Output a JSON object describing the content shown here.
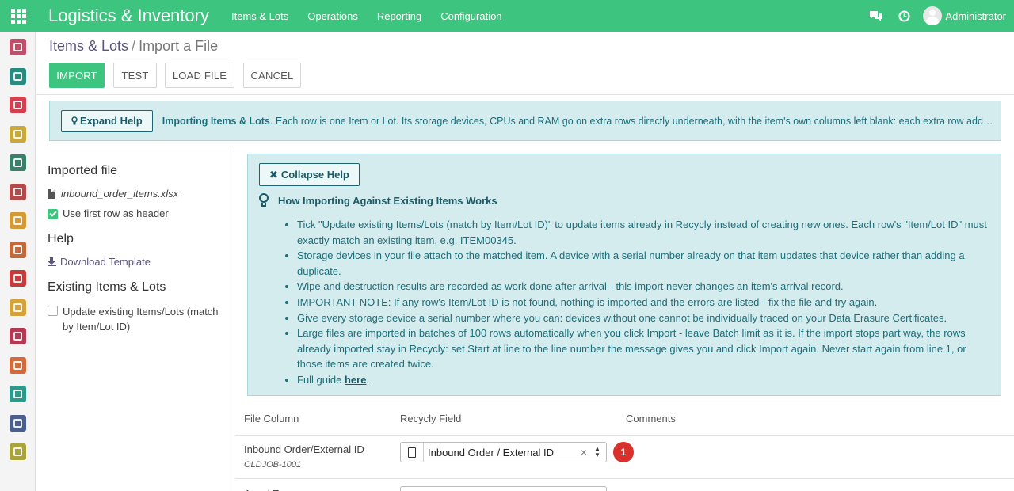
{
  "navbar": {
    "brand": "Logistics & Inventory",
    "menu": [
      "Items & Lots",
      "Operations",
      "Reporting",
      "Configuration"
    ],
    "user": "Administrator"
  },
  "sidebar_icons": [
    {
      "name": "dashboard-app-icon",
      "color": "#c0506a"
    },
    {
      "name": "contacts-app-icon",
      "color": "#2b8a80"
    },
    {
      "name": "discuss-app-icon",
      "color": "#d3404f"
    },
    {
      "name": "calendar-app-icon",
      "color": "#c8a93a"
    },
    {
      "name": "inventory-app-icon",
      "color": "#3a7f6a"
    },
    {
      "name": "stock-app-icon",
      "color": "#b5484a"
    },
    {
      "name": "packages-app-icon",
      "color": "#d49a3a"
    },
    {
      "name": "invoicing-app-icon",
      "color": "#c46a3a"
    },
    {
      "name": "marketing-app-icon",
      "color": "#c83a3a"
    },
    {
      "name": "documents-app-icon",
      "color": "#d4a43a"
    },
    {
      "name": "delivery-app-icon",
      "color": "#b33a55"
    },
    {
      "name": "website-app-icon",
      "color": "#d46a3a"
    },
    {
      "name": "employees-app-icon",
      "color": "#2b9a8a"
    },
    {
      "name": "fleet-app-icon",
      "color": "#4a5f8a"
    },
    {
      "name": "settings-app-icon",
      "color": "#a8a33a"
    }
  ],
  "breadcrumb": {
    "parent": "Items & Lots",
    "separator": "/",
    "current": "Import a File"
  },
  "toolbar": {
    "import": "IMPORT",
    "test": "TEST",
    "load_file": "LOAD FILE",
    "cancel": "CANCEL"
  },
  "helpbar": {
    "button": "Expand Help",
    "lead": "Importing Items & Lots",
    "text": ". Each row is one Item or Lot. Its storage devices, CPUs and RAM go on extra rows directly underneath, with the item's own columns left blank: each extra row add…"
  },
  "left_panel": {
    "imported_file_title": "Imported file",
    "file_name": "inbound_order_items.xlsx",
    "use_header_label": "Use first row as header",
    "help_title": "Help",
    "download_template": "Download Template",
    "existing_title": "Existing Items & Lots",
    "update_existing_label": "Update existing Items/Lots (match by Item/Lot ID)"
  },
  "help_box": {
    "button": "Collapse Help",
    "heading": "How Importing Against Existing Items Works",
    "items": [
      "Tick \"Update existing Items/Lots (match by Item/Lot ID)\" to update items already in Recycly instead of creating new ones. Each row's \"Item/Lot ID\" must exactly match an existing item, e.g. ITEM00345.",
      "Storage devices in your file attach to the matched item. A device with a serial number already on that item updates that device rather than adding a duplicate.",
      "Wipe and destruction results are recorded as work done after arrival - this import never changes an item's arrival record.",
      "IMPORTANT NOTE: If any row's Item/Lot ID is not found, nothing is imported and the errors are listed - fix the file and try again.",
      "Give every storage device a serial number where you can: devices without one cannot be individually traced on your Data Erasure Certificates.",
      "Large files are imported in batches of 100 rows automatically when you click Import - leave Batch limit as it is. If the import stops part way, the rows already imported stay in Recycly: set Start at line to the line number the message gives you and click Import again. Never start again from line 1, or those items are created twice."
    ],
    "last_item_prefix": "Full guide ",
    "last_item_link": "here",
    "last_item_suffix": "."
  },
  "table": {
    "headers": [
      "File Column",
      "Recycly Field",
      "Comments"
    ],
    "rows": [
      {
        "column": "Inbound Order/External ID",
        "sample": "OLDJOB-1001",
        "field": "Inbound Order / External ID",
        "clear": "×",
        "badge": "1"
      },
      {
        "column": "Asset Type"
      }
    ]
  }
}
